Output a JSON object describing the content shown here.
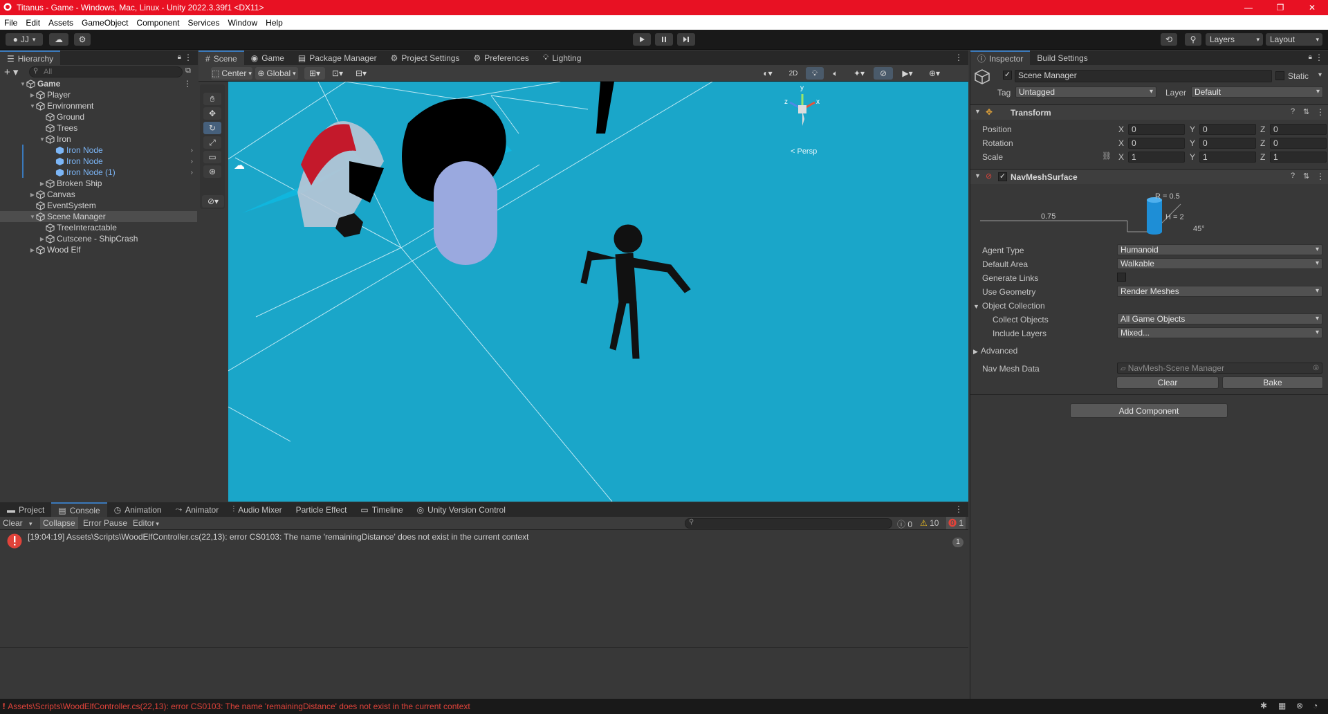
{
  "window": {
    "title": "Titanus - Game - Windows, Mac, Linux - Unity 2022.3.39f1 <DX11>",
    "controls": [
      "—",
      "❐",
      "✕"
    ]
  },
  "menu": [
    "File",
    "Edit",
    "Assets",
    "GameObject",
    "Component",
    "Services",
    "Window",
    "Help"
  ],
  "toolbar": {
    "account": "JJ",
    "layers_label": "Layers",
    "layout_label": "Layout"
  },
  "hierarchy": {
    "tab": "Hierarchy",
    "search_placeholder": "All",
    "items": [
      {
        "label": "Game",
        "depth": 0,
        "expanded": true,
        "bold": true
      },
      {
        "label": "Player",
        "depth": 1,
        "expanded": false
      },
      {
        "label": "Environment",
        "depth": 1,
        "expanded": true
      },
      {
        "label": "Ground",
        "depth": 2,
        "expanded": null
      },
      {
        "label": "Trees",
        "depth": 2,
        "expanded": null
      },
      {
        "label": "Iron",
        "depth": 2,
        "expanded": true
      },
      {
        "label": "Iron Node",
        "depth": 3,
        "prefab": true
      },
      {
        "label": "Iron Node",
        "depth": 3,
        "prefab": true
      },
      {
        "label": "Iron Node (1)",
        "depth": 3,
        "prefab": true
      },
      {
        "label": "Broken Ship",
        "depth": 2,
        "expanded": false
      },
      {
        "label": "Canvas",
        "depth": 1,
        "expanded": false
      },
      {
        "label": "EventSystem",
        "depth": 1,
        "expanded": null
      },
      {
        "label": "Scene Manager",
        "depth": 1,
        "expanded": true,
        "selected": true
      },
      {
        "label": "TreeInteractable",
        "depth": 2,
        "expanded": null
      },
      {
        "label": "Cutscene - ShipCrash",
        "depth": 2,
        "expanded": false
      },
      {
        "label": "Wood Elf",
        "depth": 1,
        "expanded": false
      }
    ]
  },
  "center_tabs": [
    "Scene",
    "Game",
    "Package Manager",
    "Project Settings",
    "Preferences",
    "Lighting"
  ],
  "scene_toolbar": {
    "pivot": "Center",
    "space": "Global",
    "mode_2d": "2D"
  },
  "scene": {
    "projection_label": "< Persp",
    "gizmo_axes": [
      "y",
      "z",
      "x"
    ]
  },
  "bottom_tabs": [
    "Project",
    "Console",
    "Animation",
    "Animator",
    "Audio Mixer",
    "Particle Effect",
    "Timeline",
    "Unity Version Control"
  ],
  "console": {
    "buttons": [
      "Clear",
      "Collapse",
      "Error Pause",
      "Editor"
    ],
    "counts": {
      "info": "0",
      "warn": "10",
      "error": "1"
    },
    "entries": [
      {
        "text": "[19:04:19] Assets\\Scripts\\WoodElfController.cs(22,13): error CS0103: The name 'remainingDistance' does not exist in the current context",
        "count": "1"
      }
    ]
  },
  "inspector": {
    "tabs": [
      "Inspector",
      "Build Settings"
    ],
    "object_name": "Scene Manager",
    "static_label": "Static",
    "tag_label": "Tag",
    "tag_value": "Untagged",
    "layer_label": "Layer",
    "layer_value": "Default",
    "transform": {
      "title": "Transform",
      "rows": [
        {
          "label": "Position",
          "x": "0",
          "y": "0",
          "z": "0"
        },
        {
          "label": "Rotation",
          "x": "0",
          "y": "0",
          "z": "0"
        },
        {
          "label": "Scale",
          "x": "1",
          "y": "1",
          "z": "1"
        }
      ],
      "axis_labels": [
        "X",
        "Y",
        "Z"
      ]
    },
    "navmesh": {
      "title": "NavMeshSurface",
      "diagram": {
        "radius": "R = 0.5",
        "height": "H = 2",
        "step": "0.75",
        "slope": "45°"
      },
      "agent_type_label": "Agent Type",
      "agent_type_value": "Humanoid",
      "default_area_label": "Default Area",
      "default_area_value": "Walkable",
      "generate_links_label": "Generate Links",
      "use_geometry_label": "Use Geometry",
      "use_geometry_value": "Render Meshes",
      "object_collection_label": "Object Collection",
      "collect_objects_label": "Collect Objects",
      "collect_objects_value": "All Game Objects",
      "include_layers_label": "Include Layers",
      "include_layers_value": "Mixed...",
      "advanced_label": "Advanced",
      "nav_mesh_data_label": "Nav Mesh Data",
      "nav_mesh_data_value": "NavMesh-Scene Manager",
      "clear_label": "Clear",
      "bake_label": "Bake"
    },
    "add_component_label": "Add Component"
  },
  "status": {
    "message": "Assets\\Scripts\\WoodElfController.cs(22,13): error CS0103: The name 'remainingDistance' does not exist in the current context"
  },
  "colors": {
    "titlebar": "#e81123",
    "scene_bg": "#18a4c8",
    "selection": "#3a79bb",
    "error": "#e0433a"
  }
}
